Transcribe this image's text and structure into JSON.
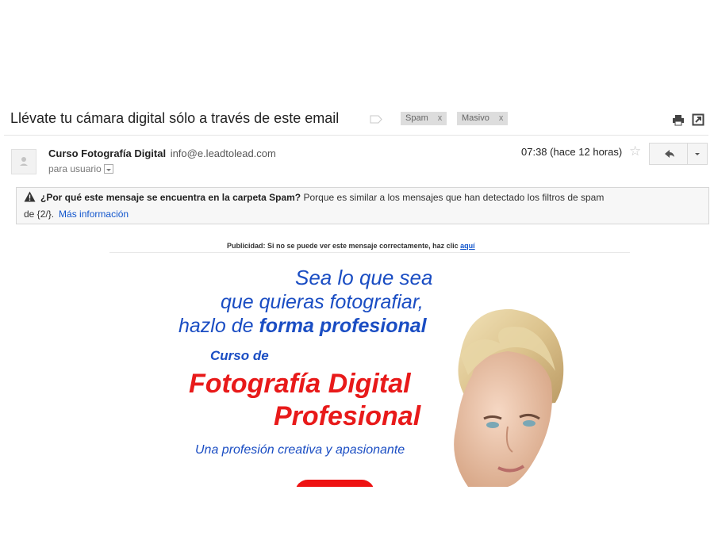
{
  "email": {
    "subject": "Llévate tu cámara digital sólo a través de este email",
    "labels": [
      {
        "name": "Spam",
        "remove": "x"
      },
      {
        "name": "Masivo",
        "remove": "x"
      }
    ],
    "sender": {
      "name": "Curso Fotografía Digital",
      "email": "info@e.leadtolead.com",
      "to_line": "para usuario"
    },
    "time": "07:38 (hace 12 horas)"
  },
  "spam_warning": {
    "bold": "¿Por qué este mensaje se encuentra en la carpeta Spam?",
    "text": "Porque es similar a los mensajes que han detectado los filtros de spam",
    "line2": "de {2/}.",
    "link": "Más información"
  },
  "ad": {
    "notice": "Publicidad: Si no se puede ver este mensaje correctamente, haz clic",
    "notice_link": "aquí",
    "tagline_1": "Sea lo que sea",
    "tagline_2": "que quieras fotografiar,",
    "tagline_3a": "hazlo de",
    "tagline_3b": "forma profesional",
    "course_of": "Curso de",
    "title_1": "Fotografía Digital",
    "title_2": "Profesional",
    "subtitle": "Una profesión creativa y apasionante"
  },
  "icons": {
    "label_tag": "label-tag-icon",
    "print": "print-icon",
    "popout": "open-in-new-window-icon",
    "avatar": "default-avatar-icon",
    "star": "star-icon",
    "reply": "reply-arrow-icon",
    "more": "chevron-down-icon",
    "warning": "warning-triangle-icon"
  },
  "colors": {
    "link_blue": "#1155cc",
    "ad_blue": "#1a4dc3",
    "ad_red": "#e81a1a",
    "chip_gray": "#dddddd"
  }
}
